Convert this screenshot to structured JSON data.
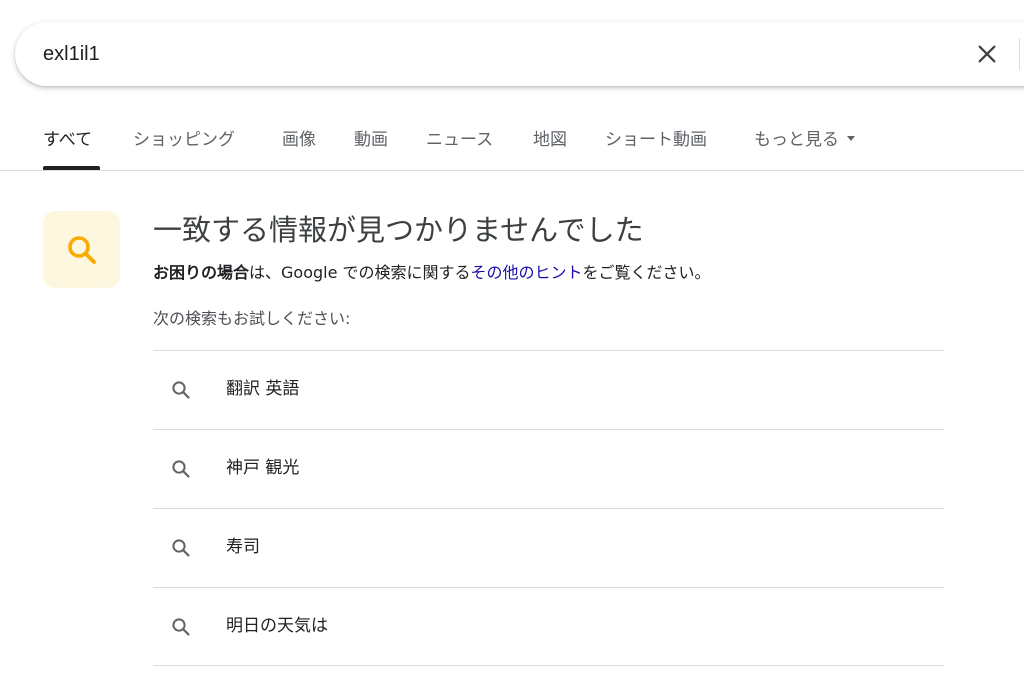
{
  "search": {
    "query": "exl1il1",
    "clear_icon": "close-icon"
  },
  "tabs": [
    {
      "label": "すべて",
      "active": true
    },
    {
      "label": "ショッピング"
    },
    {
      "label": "画像"
    },
    {
      "label": "動画"
    },
    {
      "label": "ニュース"
    },
    {
      "label": "地図"
    },
    {
      "label": "ショート動画"
    },
    {
      "label": "もっと見る",
      "icon": "caret-down-icon"
    }
  ],
  "no_results": {
    "icon": "search-icon",
    "icon_color": "#f9ab00",
    "icon_bg": "#fef7e0",
    "title": "一致する情報が見つかりませんでした",
    "hint_bold": "お困りの場合",
    "hint_pre": "は、Google での検索に関する",
    "hint_link": "その他のヒント",
    "hint_post": "をご覧ください。",
    "try_label": "次の検索もお試しください:"
  },
  "suggestions": [
    {
      "text": "翻訳 英語"
    },
    {
      "text": "神戸 観光"
    },
    {
      "text": "寿司"
    },
    {
      "text": "明日の天気は"
    }
  ],
  "colors": {
    "link": "#1a0dab",
    "tab_active": "#202124",
    "tab_inactive": "#5f6368",
    "divider": "#dadce0"
  }
}
